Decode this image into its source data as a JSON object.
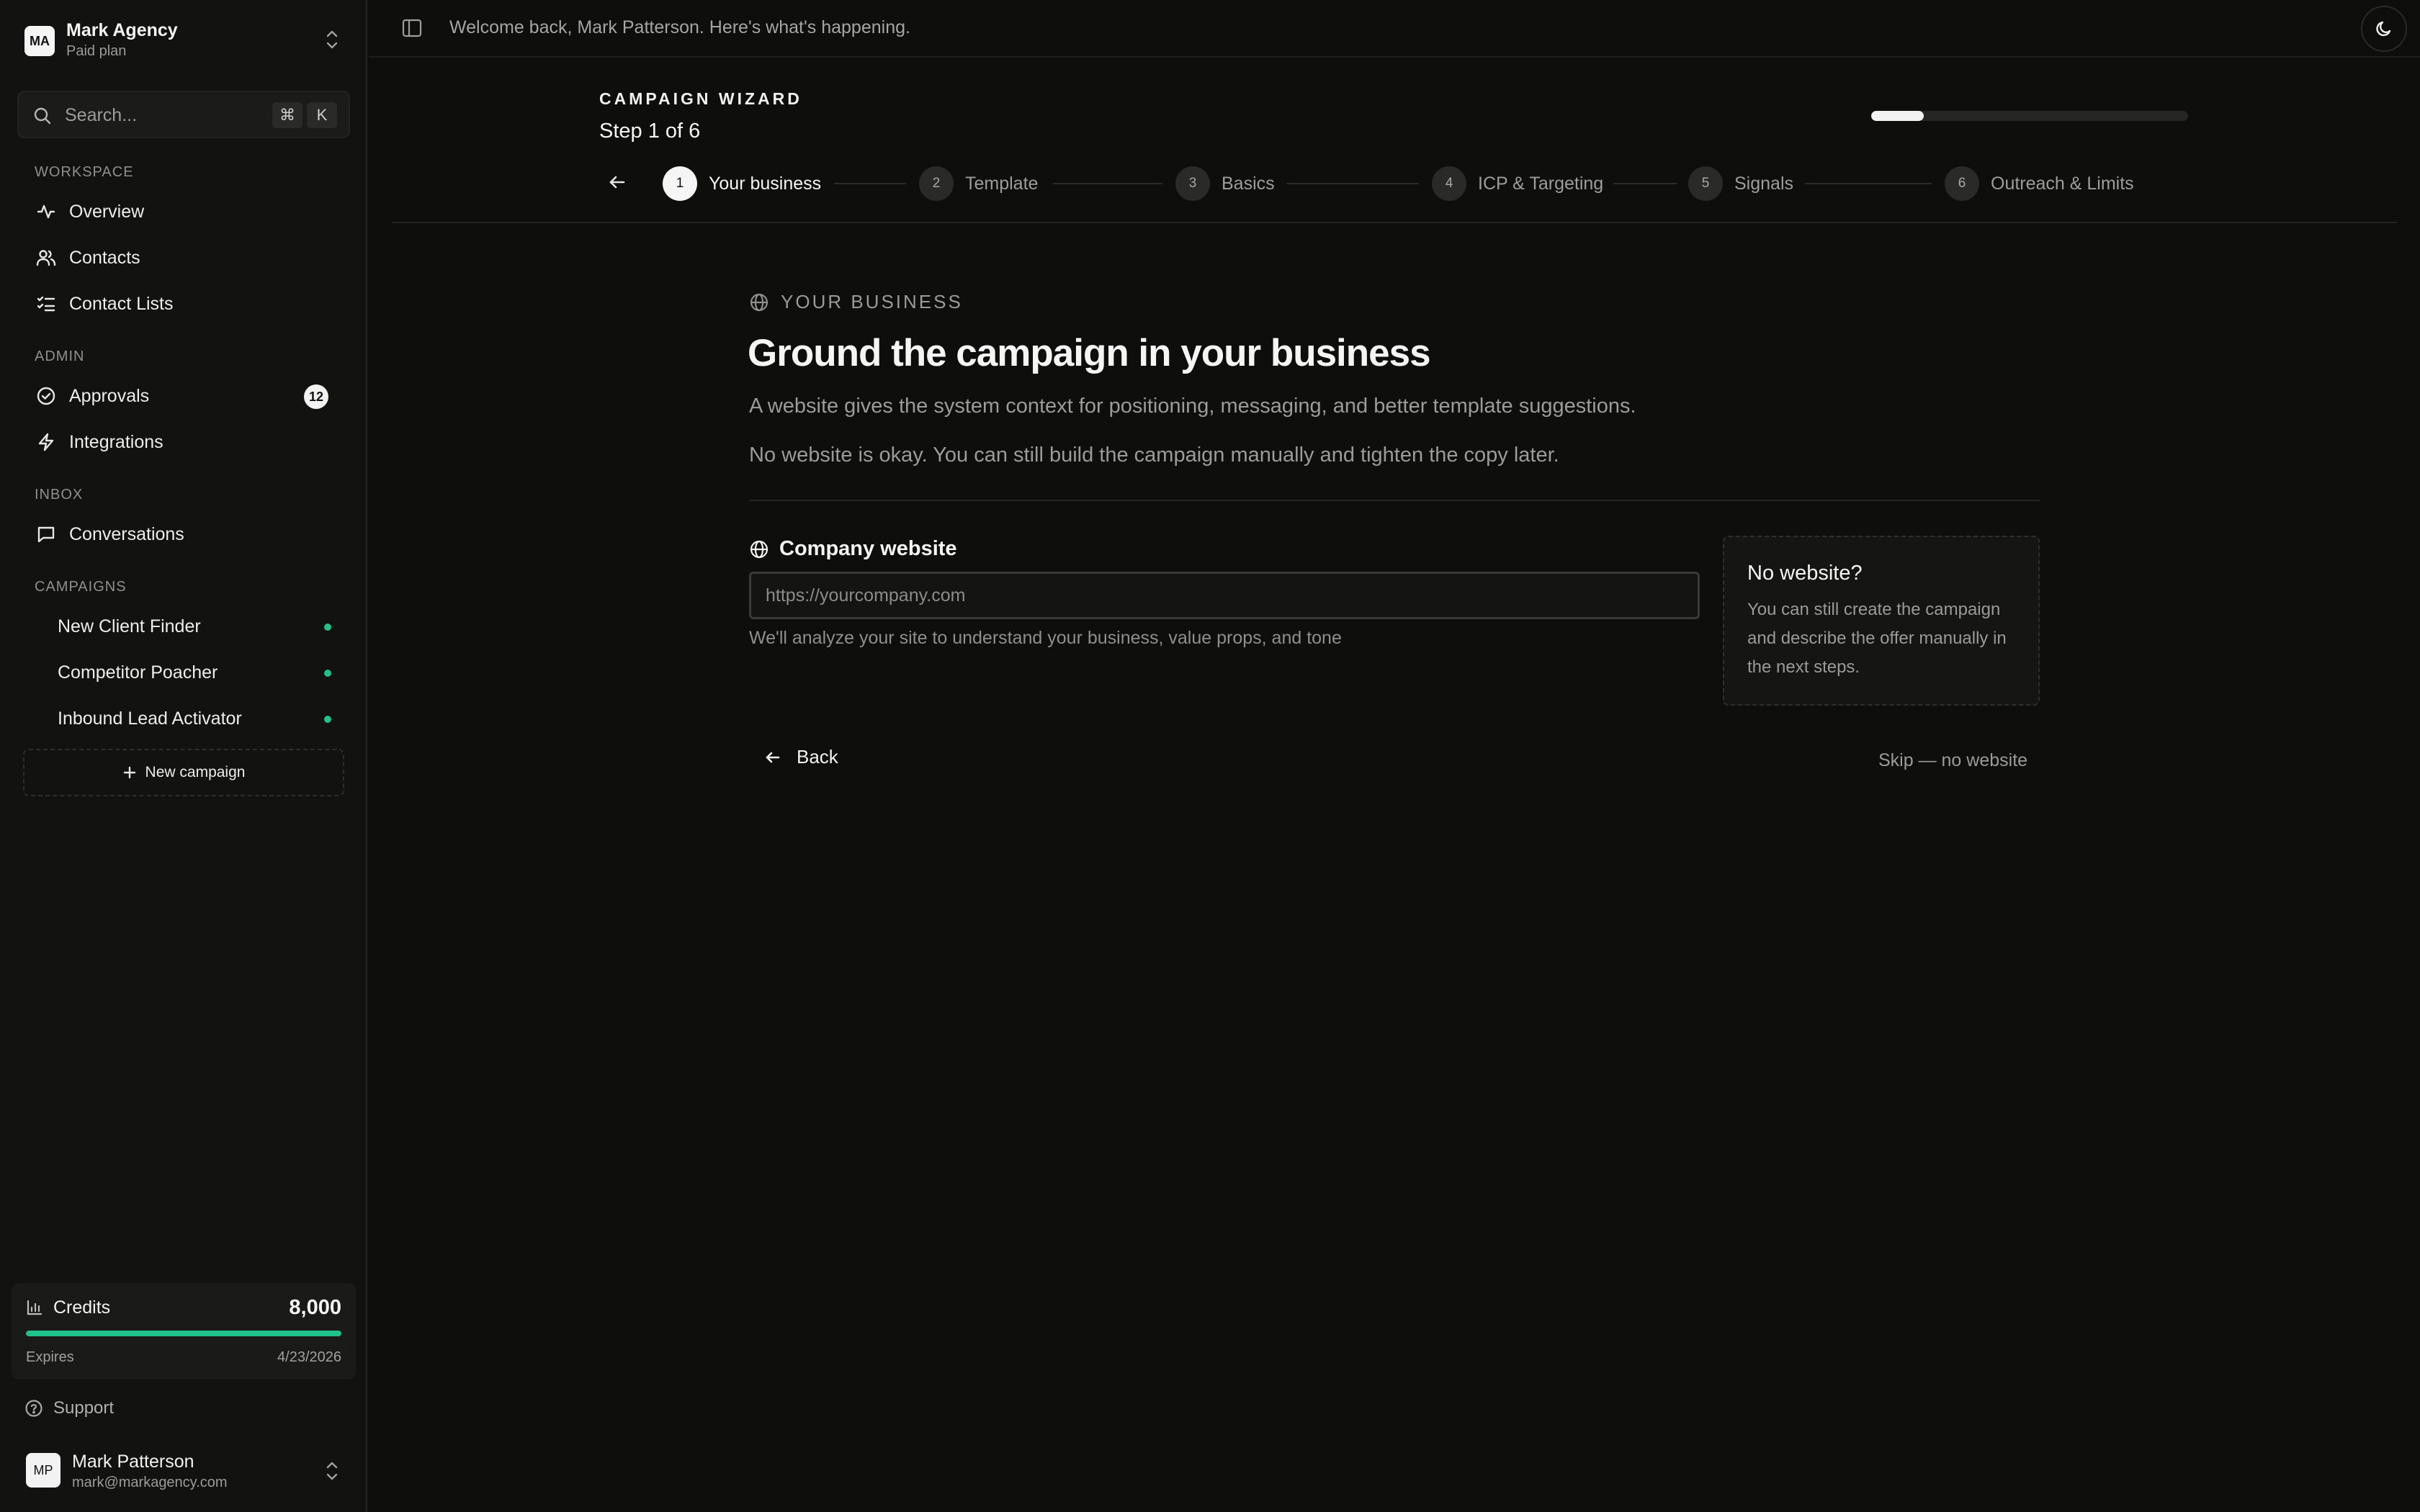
{
  "org": {
    "logo": "MA",
    "name": "Mark Agency",
    "plan": "Paid plan"
  },
  "search": {
    "placeholder": "Search...",
    "shortcut": [
      "⌘",
      "K"
    ]
  },
  "sidebar": {
    "sections": {
      "workspace": "WORKSPACE",
      "admin": "ADMIN",
      "inbox": "INBOX",
      "campaigns": "CAMPAIGNS"
    },
    "workspace": [
      {
        "label": "Overview",
        "icon": "activity-icon"
      },
      {
        "label": "Contacts",
        "icon": "users-icon"
      },
      {
        "label": "Contact Lists",
        "icon": "list-checks-icon"
      }
    ],
    "admin": [
      {
        "label": "Approvals",
        "icon": "check-circle-icon",
        "badge": "12"
      },
      {
        "label": "Integrations",
        "icon": "bolt-icon"
      }
    ],
    "inbox": [
      {
        "label": "Conversations",
        "icon": "message-square-icon"
      }
    ],
    "campaigns": [
      {
        "label": "New Client Finder",
        "status_color": "#1fc28a"
      },
      {
        "label": "Competitor Poacher",
        "status_color": "#1fc28a"
      },
      {
        "label": "Inbound Lead Activator",
        "status_color": "#1fc28a"
      }
    ],
    "new_campaign": "New campaign"
  },
  "credits": {
    "title": "Credits",
    "value": "8,000",
    "fill_fraction": 1.0,
    "expires_label": "Expires",
    "expires_date": "4/23/2026"
  },
  "support": "Support",
  "user": {
    "initials": "MP",
    "name": "Mark Patterson",
    "email": "mark@markagency.com"
  },
  "topbar": {
    "welcome": "Welcome back, Mark Patterson. Here's what's happening."
  },
  "wizard": {
    "title": "CAMPAIGN WIZARD",
    "step_text": "Step 1 of 6",
    "progress_fraction": 0.167,
    "steps": [
      {
        "num": "1",
        "label": "Your business"
      },
      {
        "num": "2",
        "label": "Template"
      },
      {
        "num": "3",
        "label": "Basics"
      },
      {
        "num": "4",
        "label": "ICP & Targeting"
      },
      {
        "num": "5",
        "label": "Signals"
      },
      {
        "num": "6",
        "label": "Outreach & Limits"
      }
    ]
  },
  "main": {
    "eyebrow": "YOUR BUSINESS",
    "heading": "Ground the campaign in your business",
    "desc1": "A website gives the system context for positioning, messaging, and better template suggestions.",
    "desc2": "No website is okay. You can still build the campaign manually and tighten the copy later.",
    "field_label": "Company website",
    "input_placeholder": "https://yourcompany.com",
    "input_value": "",
    "helper": "We'll analyze your site to understand your business, value props, and tone",
    "no_website": {
      "title": "No website?",
      "body": "You can still create the campaign and describe the offer manually in the next steps."
    },
    "back": "Back",
    "skip": "Skip — no website"
  },
  "colors": {
    "accent_green": "#1fc28a",
    "background": "#0e0e0d",
    "sidebar": "#121211"
  }
}
